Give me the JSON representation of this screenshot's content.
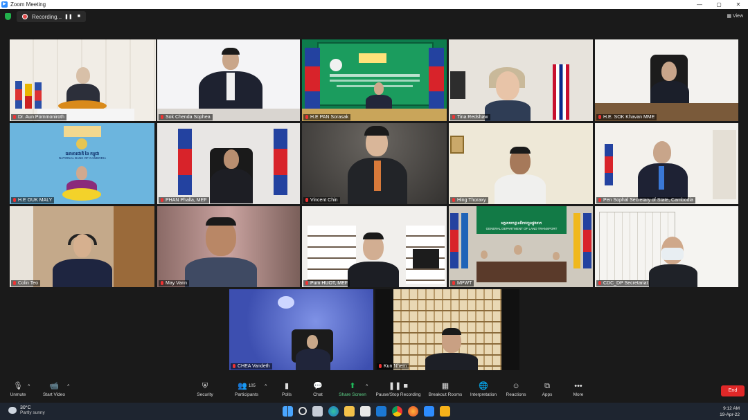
{
  "window": {
    "title": "Zoom Meeting",
    "controls": [
      "—",
      "▢",
      "✕"
    ]
  },
  "recording": {
    "label": "Recording...",
    "pause": "❚❚",
    "stop": "■"
  },
  "view_label": "View",
  "participants": [
    "Dr. Aun Pornmoniroth",
    "Sok Chenda Sophea",
    "H.E PAN Sorasak",
    "Tina Redshaw",
    "H.E. SOK Khavan MME",
    "H.E OUK MALY",
    "PHAN Phalla, MEF",
    "Vincent Chin",
    "Hing Thoraxy",
    "Pen Sophal Secretary of State, Cambodia",
    "Colin Teo",
    "May Vann",
    "Pum HUOT, MEF",
    "MPWT",
    "CDC_DP Secretariat",
    "CHEA Vandeth",
    "Kun Nhem"
  ],
  "tile_text": {
    "mpwt_banner_kh": "អគ្គនាយកដ្ឋានដឹកជញ្ជូនផ្លូវគោក",
    "mpwt_banner_en": "GENERAL DEPARTMENT OF LAND TRANSPORT",
    "nbc_kh": "ធនាគារជាតិ នៃ កម្ពុជា",
    "nbc_en": "NATIONAL BANK OF CAMBODIA"
  },
  "toolbar": {
    "unmute": "Unmute",
    "start_video": "Start Video",
    "security": "Security",
    "participants": "Participants",
    "participants_count": "105",
    "polls": "Polls",
    "chat": "Chat",
    "share_screen": "Share Screen",
    "record": "Pause/Stop Recording",
    "breakout": "Breakout Rooms",
    "interpretation": "Interpretation",
    "reactions": "Reactions",
    "apps": "Apps",
    "more": "More",
    "end": "End"
  },
  "taskbar": {
    "temperature": "30°C",
    "weather": "Partly sunny",
    "time": "9:12 AM",
    "date": "19-Apr-22"
  },
  "icons": [
    "microphone-muted-icon",
    "video-off-icon",
    "shield-icon",
    "people-icon",
    "bar-chart-icon",
    "chat-bubble-icon",
    "share-screen-icon",
    "record-icon",
    "grid-icon",
    "globe-icon",
    "smile-icon",
    "apps-icon",
    "more-dots-icon"
  ],
  "colors": {
    "end": "#e02828",
    "share": "#1fbb5a",
    "active_speaker": "#f6e94a",
    "recording_dot": "#e04a4a"
  }
}
